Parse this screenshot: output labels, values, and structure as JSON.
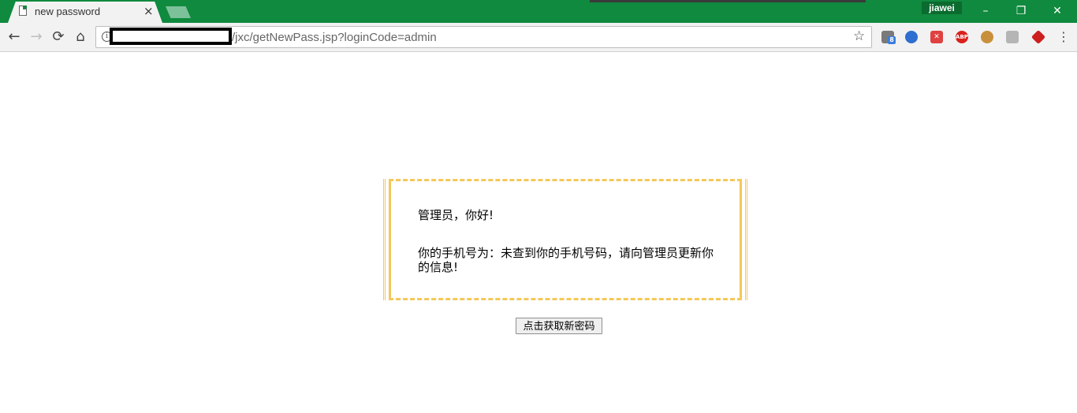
{
  "browser": {
    "tab": {
      "title": "new password",
      "close": "×"
    },
    "profile": "jiawei",
    "window_controls": {
      "minimize": "–",
      "restore": "❐",
      "close": "✕"
    },
    "nav": {
      "back": "←",
      "forward": "→",
      "reload": "⟳",
      "home": "⌂"
    },
    "address": {
      "url": "/jxc/getNewPass.jsp?loginCode=admin",
      "info": "i",
      "bookmark_star": "☆"
    },
    "extensions": [
      {
        "name": "mail-extension-icon",
        "badge": "8",
        "color": "#7a7a7a"
      },
      {
        "name": "globe-extension-icon",
        "color": "#2f6fcf"
      },
      {
        "name": "x-extension-icon",
        "color": "#e04040"
      },
      {
        "name": "adblock-plus-icon",
        "label": "ABP",
        "color": "#d9221c"
      },
      {
        "name": "cookie-extension-icon",
        "color": "#c8903b"
      },
      {
        "name": "search-extension-icon",
        "color": "#b5b5b5"
      },
      {
        "name": "diamond-extension-icon",
        "color": "#cc1f1f"
      }
    ],
    "menu": "⋮",
    "theme_color": "#0f8a3e"
  },
  "content": {
    "greeting": "管理员，你好!",
    "message": "你的手机号为：未查到你的手机号码，请向管理员更新你的信息!",
    "button_label": "点击获取新密码",
    "border_color": "#f5c85a"
  }
}
